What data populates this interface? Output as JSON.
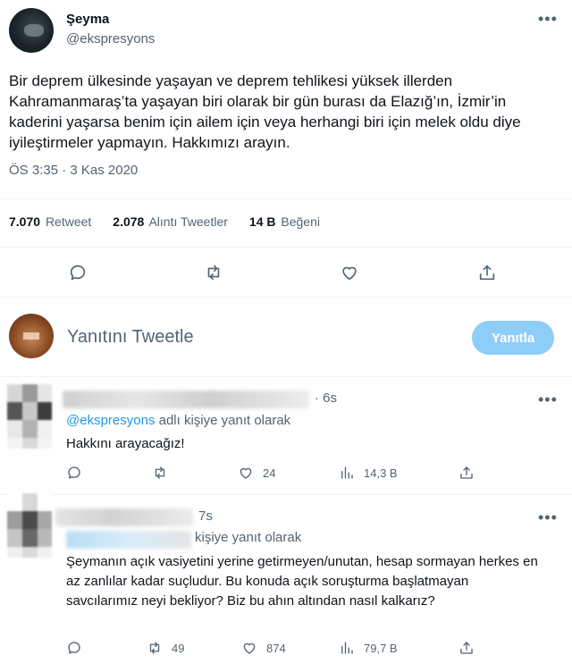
{
  "tweet": {
    "author_name": "Şeyma",
    "author_handle": "@ekspresyons",
    "text": "Bir deprem ülkesinde yaşayan ve deprem tehlikesi yüksek illerden Kahramanmaraş’ta yaşayan biri olarak bir gün burası da Elazığ’ın, İzmir’in kaderini yaşarsa benim için ailem için veya herhangi biri için melek oldu diye iyileştirmeler yapmayın. Hakkımızı arayın.",
    "timestamp": "ÖS 3:35 · 3 Kas 2020",
    "stats": {
      "retweets_count": "7.070",
      "retweets_label": "Retweet",
      "quotes_count": "2.078",
      "quotes_label": "Alıntı Tweetler",
      "likes_count": "14 B",
      "likes_label": "Beğeni"
    },
    "actions": [
      "reply-icon",
      "retweet-icon",
      "like-icon",
      "share-icon"
    ]
  },
  "composer": {
    "placeholder": "Yanıtını Tweetle",
    "button_label": "Yanıtla",
    "button_color": "#8ecdf8"
  },
  "replies": [
    {
      "time": "6s",
      "context_mention": "@ekspresyons",
      "context_suffix": " adlı kişiye yanıt olarak",
      "text": "Hakkını arayacağız!",
      "likes": "24",
      "views": "14,3 B",
      "retweets": ""
    },
    {
      "time": "7s",
      "context_mention": "",
      "context_suffix": "kişiye yanıt olarak",
      "text": "Şeymanın açık vasiyetini yerine getirmeyen/unutan, hesap sormayan herkes en az zanlılar kadar suçludur. Bu konuda açık soruşturma başlatmayan savcılarımız neyi bekliyor? Biz bu ahın altından nasıl kalkarız?",
      "retweets": "49",
      "likes": "874",
      "views": "79,7 B"
    }
  ],
  "colors": {
    "link": "#1d9bf0",
    "muted": "#536471",
    "text": "#0f1419"
  }
}
